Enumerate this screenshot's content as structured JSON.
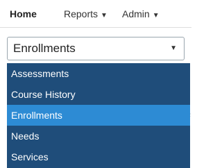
{
  "nav": {
    "items": [
      {
        "label": "Home",
        "active": true,
        "has_dropdown": false
      },
      {
        "label": "Reports",
        "active": false,
        "has_dropdown": true
      },
      {
        "label": "Admin",
        "active": false,
        "has_dropdown": true
      }
    ],
    "dropdown_caret": "▼"
  },
  "select": {
    "value": "Enrollments",
    "caret": "▼"
  },
  "dropdown": {
    "options": [
      {
        "label": "Assessments",
        "selected": false
      },
      {
        "label": "Course History",
        "selected": false
      },
      {
        "label": "Enrollments",
        "selected": true
      },
      {
        "label": "Needs",
        "selected": false
      },
      {
        "label": "Services",
        "selected": false
      }
    ]
  },
  "background_fragment": "F",
  "colors": {
    "dropdown_bg": "#1f4d7a",
    "selected_bg": "#2d8bd4",
    "option_text": "#ffffff"
  }
}
